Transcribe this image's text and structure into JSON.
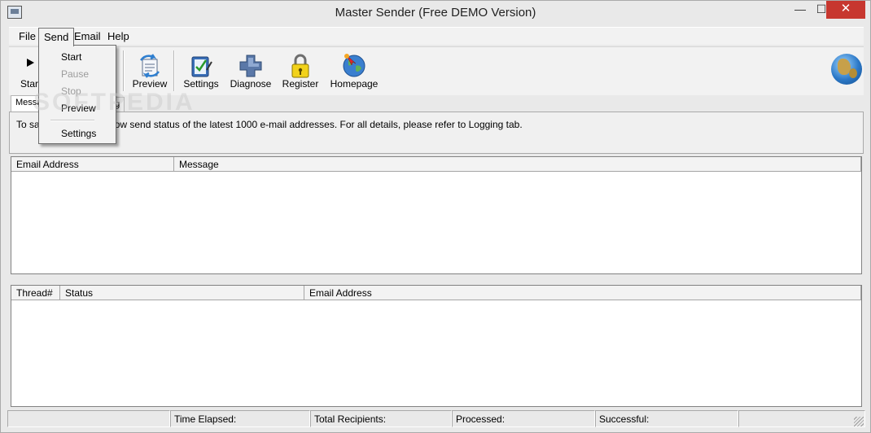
{
  "window": {
    "title": "Master Sender (Free DEMO Version)",
    "minimize": "—",
    "maximize": "☐",
    "close": "✕"
  },
  "menu": {
    "file": "File",
    "send": "Send",
    "email": "Email",
    "help": "Help"
  },
  "send_menu": {
    "start": "Start",
    "pause": "Pause",
    "stop": "Stop",
    "preview": "Preview",
    "settings": "Settings"
  },
  "toolbar": {
    "start": "Start",
    "preview": "Preview",
    "settings": "Settings",
    "diagnose": "Diagnose",
    "register": "Register",
    "homepage": "Homepage"
  },
  "tabs": {
    "messages": "Messa",
    "logging": "ng"
  },
  "info_text": "To sa                     y show send status of the latest 1000 e-mail addresses. For all details, please refer to Logging tab.",
  "list1": {
    "columns": [
      "Email Address",
      "Message"
    ]
  },
  "list2": {
    "columns": [
      "Thread#",
      "Status",
      "Email Address"
    ]
  },
  "status": {
    "time_elapsed": "Time Elapsed:",
    "total_recipients": "Total Recipients:",
    "processed": "Processed:",
    "successful": "Successful:"
  },
  "watermark": "SOFTPEDIA",
  "colors": {
    "close_button": "#c7372f",
    "window_bg": "#e9e9e9",
    "list_bg": "#ffffff"
  }
}
